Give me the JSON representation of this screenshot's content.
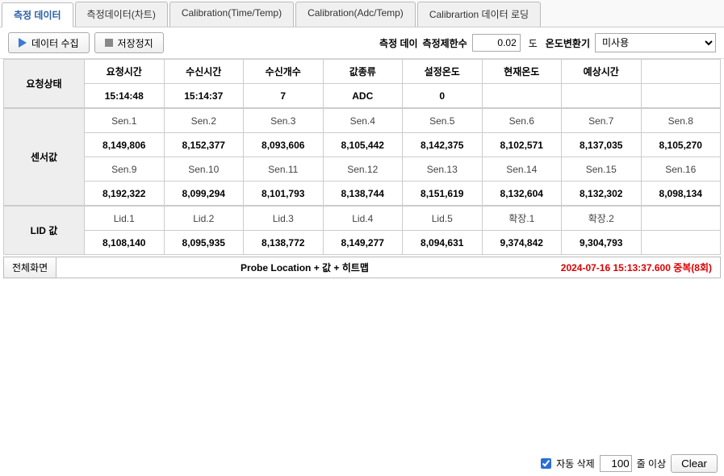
{
  "tabs": [
    "측정 데이터",
    "측정데이터(차트)",
    "Calibration(Time/Temp)",
    "Calibration(Adc/Temp)",
    "Calibrartion 데이터 로딩"
  ],
  "toolbar": {
    "collect": "데이터 수집",
    "stop": "저장정지",
    "measure_label": "측정 데이",
    "limit_label": "측정제한수",
    "limit_value": "0.02",
    "limit_unit": "도",
    "temp_converter": "온도변환기",
    "select_value": "미사용"
  },
  "status": {
    "row_label": "요청상태",
    "headers": [
      "요청시간",
      "수신시간",
      "수신개수",
      "값종류",
      "설정온도",
      "현재온도",
      "예상시간"
    ],
    "values": [
      "15:14:48",
      "15:14:37",
      "7",
      "ADC",
      "0",
      "",
      ""
    ]
  },
  "sensor": {
    "row_label": "센서값",
    "headers1": [
      "Sen.1",
      "Sen.2",
      "Sen.3",
      "Sen.4",
      "Sen.5",
      "Sen.6",
      "Sen.7",
      "Sen.8"
    ],
    "values1": [
      "8,149,806",
      "8,152,377",
      "8,093,606",
      "8,105,442",
      "8,142,375",
      "8,102,571",
      "8,137,035",
      "8,105,270"
    ],
    "headers2": [
      "Sen.9",
      "Sen.10",
      "Sen.11",
      "Sen.12",
      "Sen.13",
      "Sen.14",
      "Sen.15",
      "Sen.16"
    ],
    "values2": [
      "8,192,322",
      "8,099,294",
      "8,101,793",
      "8,138,744",
      "8,151,619",
      "8,132,604",
      "8,132,302",
      "8,098,134"
    ]
  },
  "lid": {
    "row_label": "LID 값",
    "headers": [
      "Lid.1",
      "Lid.2",
      "Lid.3",
      "Lid.4",
      "Lid.5",
      "확장.1",
      "확장.2"
    ],
    "values": [
      "8,108,140",
      "8,095,935",
      "8,138,772",
      "8,149,277",
      "8,094,631",
      "9,374,842",
      "9,304,793"
    ]
  },
  "footer": {
    "fullscreen": "전체화면",
    "title": "Probe Location + 값 + 히트맵",
    "status": "2024-07-16 15:13:37.600 중복(8회)"
  },
  "bottom": {
    "auto_delete": "자동 삭제",
    "lines_value": "100",
    "lines_unit": "줄 이상",
    "clear": "Clear"
  }
}
